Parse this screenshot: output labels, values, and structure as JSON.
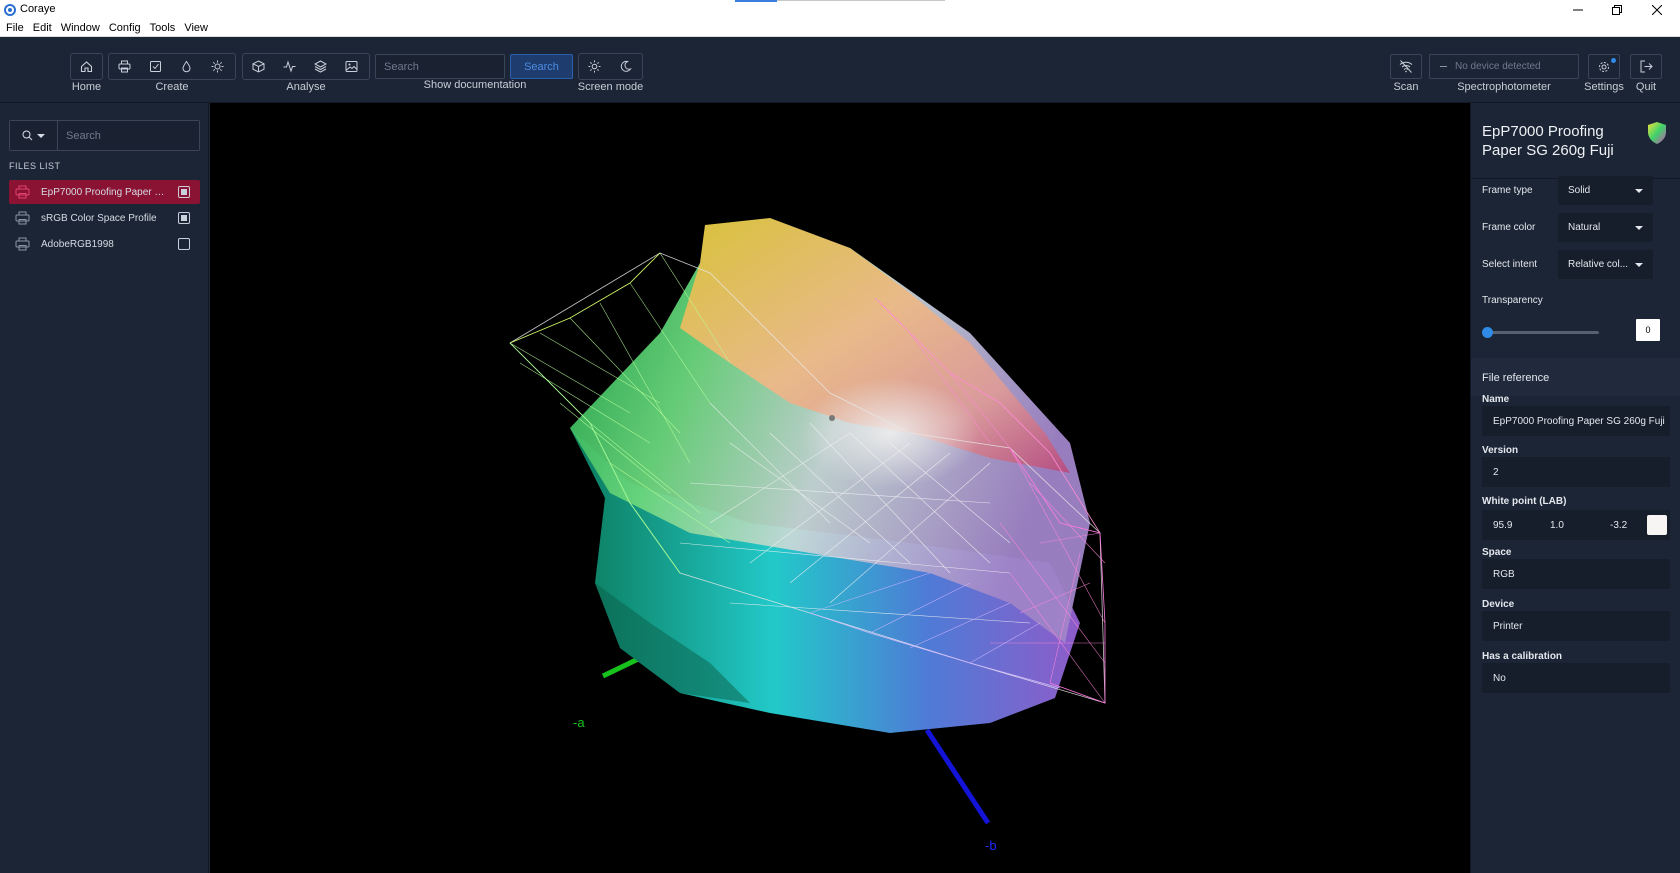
{
  "window": {
    "title": "Coraye",
    "controls": [
      "minimize",
      "restore",
      "close"
    ]
  },
  "menu": [
    "File",
    "Edit",
    "Window",
    "Config",
    "Tools",
    "View"
  ],
  "toolbar": {
    "groups": [
      {
        "label": "Home",
        "icons": [
          "home-icon"
        ]
      },
      {
        "label": "Create",
        "icons": [
          "printer-icon",
          "check-document-icon",
          "droplet-icon",
          "sun-settings-icon"
        ]
      },
      {
        "label": "Analyse",
        "icons": [
          "cube-icon",
          "graph-icon",
          "layers-icon",
          "image-icon"
        ]
      },
      {
        "label": "Screen mode",
        "icons": [
          "light-mode-icon",
          "dark-mode-icon"
        ]
      }
    ],
    "search_placeholder": "Search",
    "search_button": "Search",
    "show_documentation": "Show documentation",
    "scan_label": "Scan",
    "device_status": "No device detected",
    "spectro_label": "Spectrophotometer",
    "settings_label": "Settings",
    "quit_label": "Quit"
  },
  "left_panel": {
    "filter_placeholder": "Search",
    "files_title": "FILES LIST",
    "files": [
      {
        "name": "EpP7000 Proofing Paper SG 260g Fuji",
        "checked": true,
        "active": true
      },
      {
        "name": "sRGB Color Space Profile",
        "checked": true,
        "active": false
      },
      {
        "name": "AdobeRGB1998",
        "checked": false,
        "active": false
      }
    ]
  },
  "viewer": {
    "axis_labels": [
      "-a",
      "-b"
    ],
    "colors": {
      "axis_a": "#16c21b",
      "axis_b": "#1414d8",
      "background": "#000000"
    }
  },
  "right_panel": {
    "title": "EpP7000 Proofing Paper SG 260g Fuji",
    "frame_type_label": "Frame type",
    "frame_type": "Solid",
    "frame_color_label": "Frame color",
    "frame_color": "Natural",
    "intent_label": "Select intent",
    "intent": "Relative col...",
    "transparency_label": "Transparency",
    "transparency": "0",
    "file_reference": "File reference",
    "name_label": "Name",
    "name": "EpP7000 Proofing Paper SG 260g Fuji",
    "version_label": "Version",
    "version": "2",
    "white_point_label": "White point (LAB)",
    "white_point": {
      "L": "95.9",
      "a": "1.0",
      "b": "-3.2"
    },
    "space_label": "Space",
    "space": "RGB",
    "device_label": "Device",
    "device": "Printer",
    "calibration_label": "Has a calibration",
    "calibration": "No"
  },
  "theme": {
    "active_file": "#8a1233",
    "accent": "#2f8be6",
    "panel": "#1c2535"
  }
}
